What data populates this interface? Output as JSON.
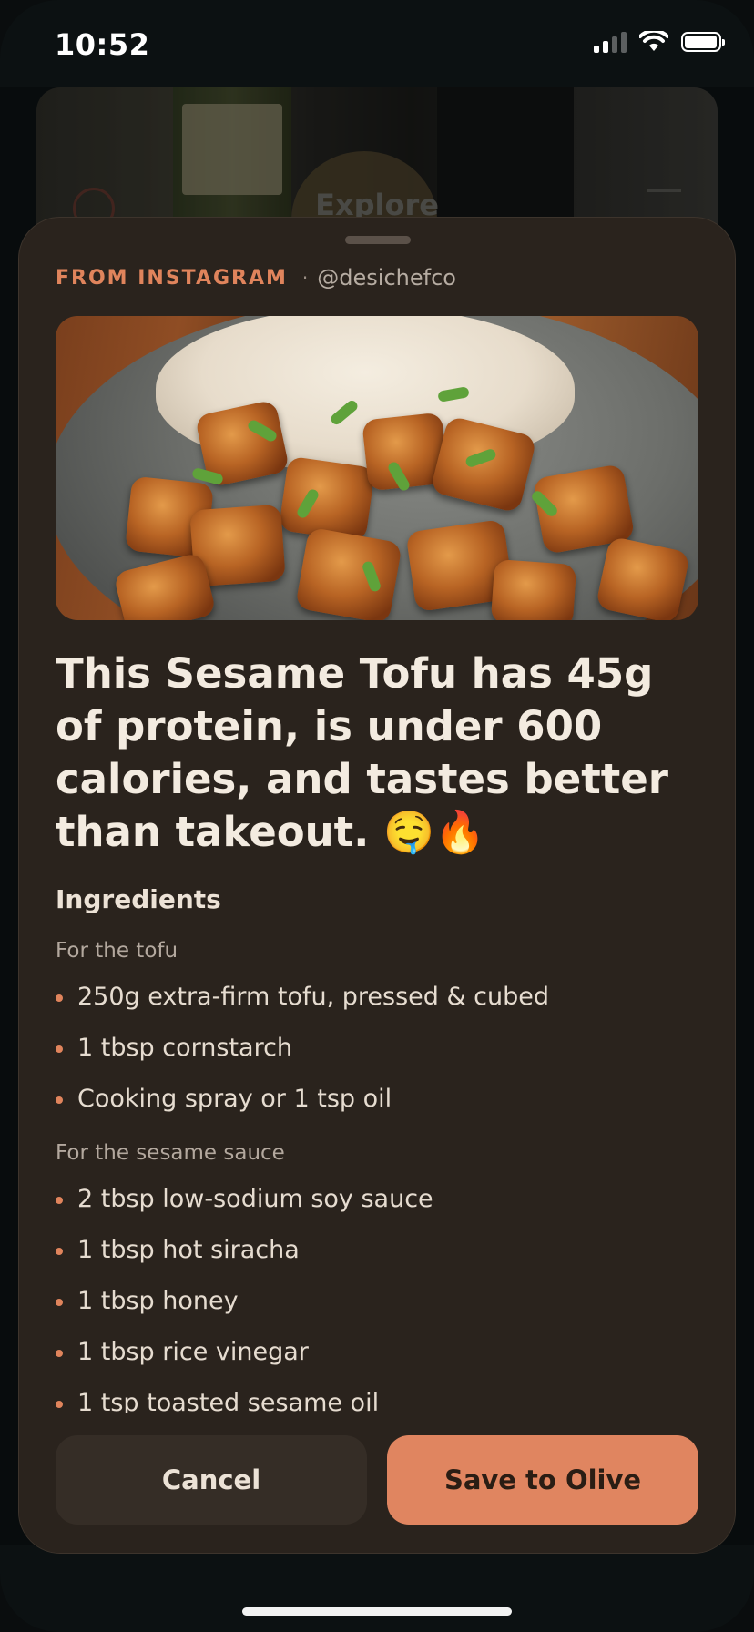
{
  "status_bar": {
    "time": "10:52",
    "icons": [
      "cellular-signal-icon",
      "wifi-icon",
      "battery-icon"
    ]
  },
  "background_screen": {
    "title": "Explore"
  },
  "sheet": {
    "source_label": "FROM INSTAGRAM",
    "source_separator": "·",
    "source_handle": "@desichefco",
    "hero_image_alt": "sesame-tofu-photo",
    "title": "This Sesame Tofu has 45g of protein, is under 600 calories, and tastes better than takeout. 🤤🔥",
    "ingredients_heading": "Ingredients",
    "sections": [
      {
        "label": "For the tofu",
        "items": [
          "250g extra-firm tofu, pressed & cubed",
          "1 tbsp cornstarch",
          "Cooking spray or 1 tsp oil"
        ]
      },
      {
        "label": "For the sesame sauce",
        "items": [
          "2 tbsp low-sodium soy sauce",
          "1 tbsp hot siracha",
          "1 tbsp honey",
          "1 tbsp rice vinegar",
          "1 tsp toasted sesame oil"
        ]
      }
    ]
  },
  "actions": {
    "cancel_label": "Cancel",
    "save_label": "Save to Olive"
  },
  "colors": {
    "accent": "#e0845c",
    "sheet_background": "#2a231d",
    "save_button": "#e08560"
  }
}
